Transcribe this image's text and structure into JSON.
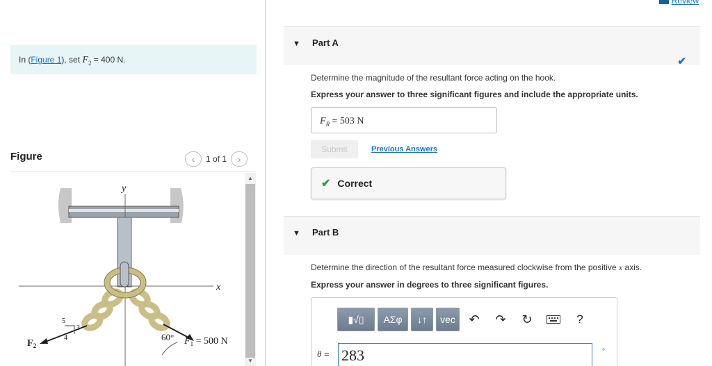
{
  "prompt": {
    "prefix": "In (",
    "figure_link": "Figure 1",
    "mid": "), set ",
    "var": "F",
    "var_sub": "2",
    "value": " = 400 N."
  },
  "figure": {
    "title": "Figure",
    "pager_text": "1 of 1",
    "labels": {
      "y": "y",
      "x": "x",
      "f2": "F",
      "f2_sub": "2",
      "f1_eq": "F",
      "f1_sub": "1",
      "f1_val": " = 500 N",
      "angle": "60°",
      "tri_5": "5",
      "tri_3": "3",
      "tri_4": "4"
    }
  },
  "header": {
    "review_label": "Review"
  },
  "part_a": {
    "label": "Part A",
    "question": "Determine the magnitude of the resultant force acting on the hook.",
    "instruction": "Express your answer to three significant figures and include the appropriate units.",
    "answer_var": "F",
    "answer_sub": "R",
    "answer_eq": " = ",
    "answer_value": "503 N",
    "submit_label": "Submit",
    "previous_answers_label": "Previous Answers",
    "feedback": "Correct"
  },
  "part_b": {
    "label": "Part B",
    "question_pre": "Determine the direction of the resultant force measured clockwise from the positive ",
    "question_var": "x",
    "question_post": " axis.",
    "instruction": "Express your answer in degrees to three significant figures.",
    "toolbar": {
      "templates_label": "▮√▯",
      "greek_label": "ΑΣφ",
      "arrows_label": "↓↑",
      "vec_label": "vec",
      "undo_icon": "↶",
      "redo_icon": "↷",
      "reset_icon": "↻",
      "help_label": "?"
    },
    "theta_symbol": "θ",
    "theta_eq": " = ",
    "theta_value": "283",
    "unit": "°"
  },
  "colors": {
    "link": "#1a75bb",
    "correct": "#2a9d3a",
    "prompt_bg": "#e8f5f7"
  }
}
